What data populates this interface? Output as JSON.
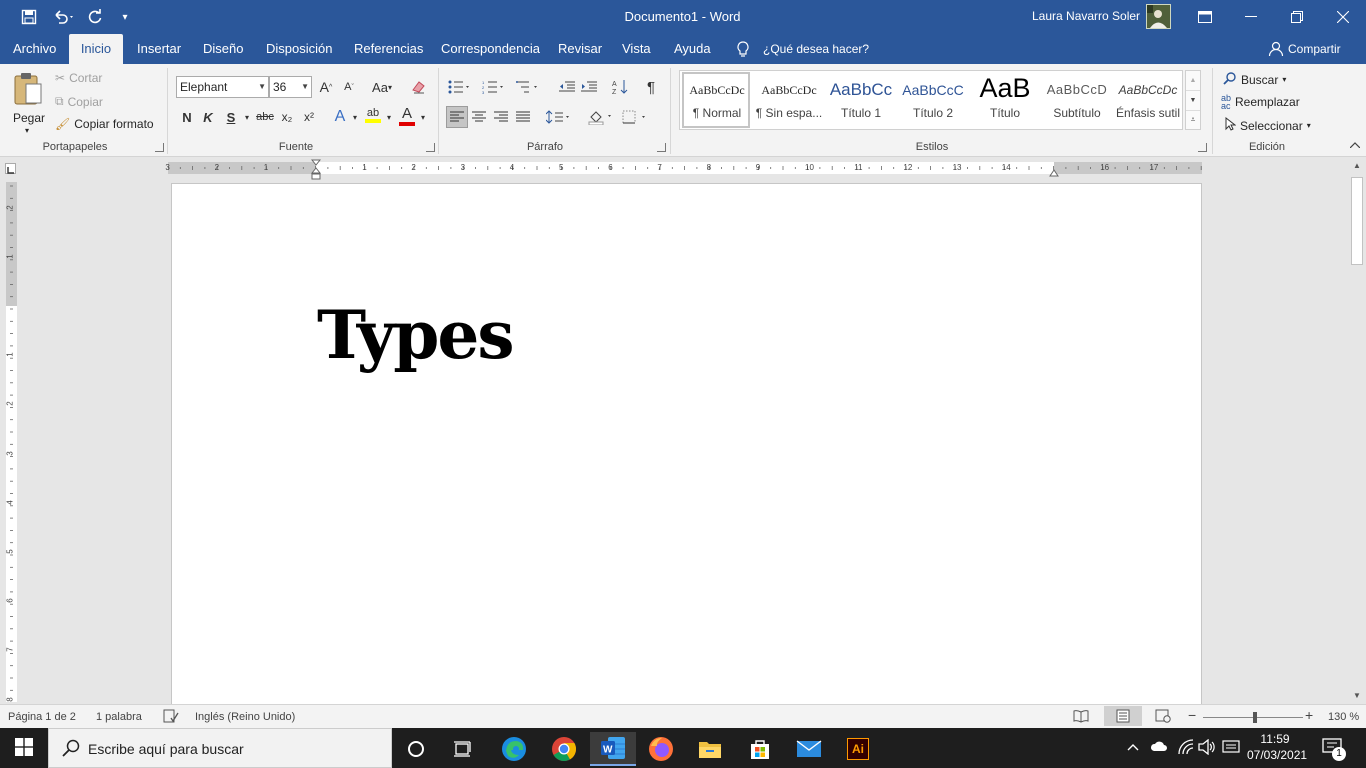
{
  "titlebar": {
    "doc_title": "Documento1  -  Word",
    "user_name": "Laura Navarro Soler"
  },
  "tabs": [
    {
      "label": "Archivo"
    },
    {
      "label": "Inicio"
    },
    {
      "label": "Insertar"
    },
    {
      "label": "Diseño"
    },
    {
      "label": "Disposición"
    },
    {
      "label": "Referencias"
    },
    {
      "label": "Correspondencia"
    },
    {
      "label": "Revisar"
    },
    {
      "label": "Vista"
    },
    {
      "label": "Ayuda"
    }
  ],
  "tellme": "¿Qué desea hacer?",
  "share": "Compartir",
  "clipboard": {
    "paste": "Pegar",
    "cut": "Cortar",
    "copy": "Copiar",
    "format_painter": "Copiar formato",
    "group": "Portapapeles"
  },
  "font": {
    "name": "Elephant",
    "size": "36",
    "bold": "N",
    "italic": "K",
    "underline": "S",
    "strike": "abc",
    "sub": "x₂",
    "sup": "x²",
    "case": "Aa",
    "grow": "A",
    "shrink": "A",
    "font_color": "A",
    "effects": "A",
    "highlight": "ab",
    "group": "Fuente"
  },
  "paragraph": {
    "group": "Párrafo",
    "pilcrow": "¶"
  },
  "styles": {
    "group": "Estilos",
    "items": [
      {
        "preview": "AaBbCcDc",
        "name": "¶ Normal"
      },
      {
        "preview": "AaBbCcDc",
        "name": "¶ Sin espa..."
      },
      {
        "preview": "AaBbCc",
        "name": "Título 1"
      },
      {
        "preview": "AaBbCcC",
        "name": "Título 2"
      },
      {
        "preview": "AaB",
        "name": "Título"
      },
      {
        "preview": "AaBbCcD",
        "name": "Subtítulo"
      },
      {
        "preview": "AaBbCcDc",
        "name": "Énfasis sutil"
      }
    ]
  },
  "editing": {
    "group": "Edición",
    "find": "Buscar",
    "replace": "Reemplazar",
    "select": "Seleccionar"
  },
  "ruler": {
    "h_ticks": [
      "3",
      "2",
      "1",
      "1",
      "2",
      "3",
      "4",
      "5",
      "6",
      "7",
      "8",
      "9",
      "10",
      "11",
      "12",
      "13",
      "14",
      "16",
      "17"
    ],
    "v_ticks": [
      "2",
      "1",
      "1",
      "2",
      "3",
      "4",
      "5",
      "6",
      "7",
      "8"
    ]
  },
  "document": {
    "text": "Types"
  },
  "status": {
    "page": "Página 1 de 2",
    "words": "1 palabra",
    "language": "Inglés (Reino Unido)",
    "zoom": "130 %"
  },
  "taskbar": {
    "search_placeholder": "Escribe aquí para buscar",
    "time": "11:59",
    "date": "07/03/2021",
    "notif_count": "1",
    "ai_label": "Ai"
  },
  "colors": {
    "accent": "#2b579a",
    "taskbar": "#1e1e1e"
  }
}
